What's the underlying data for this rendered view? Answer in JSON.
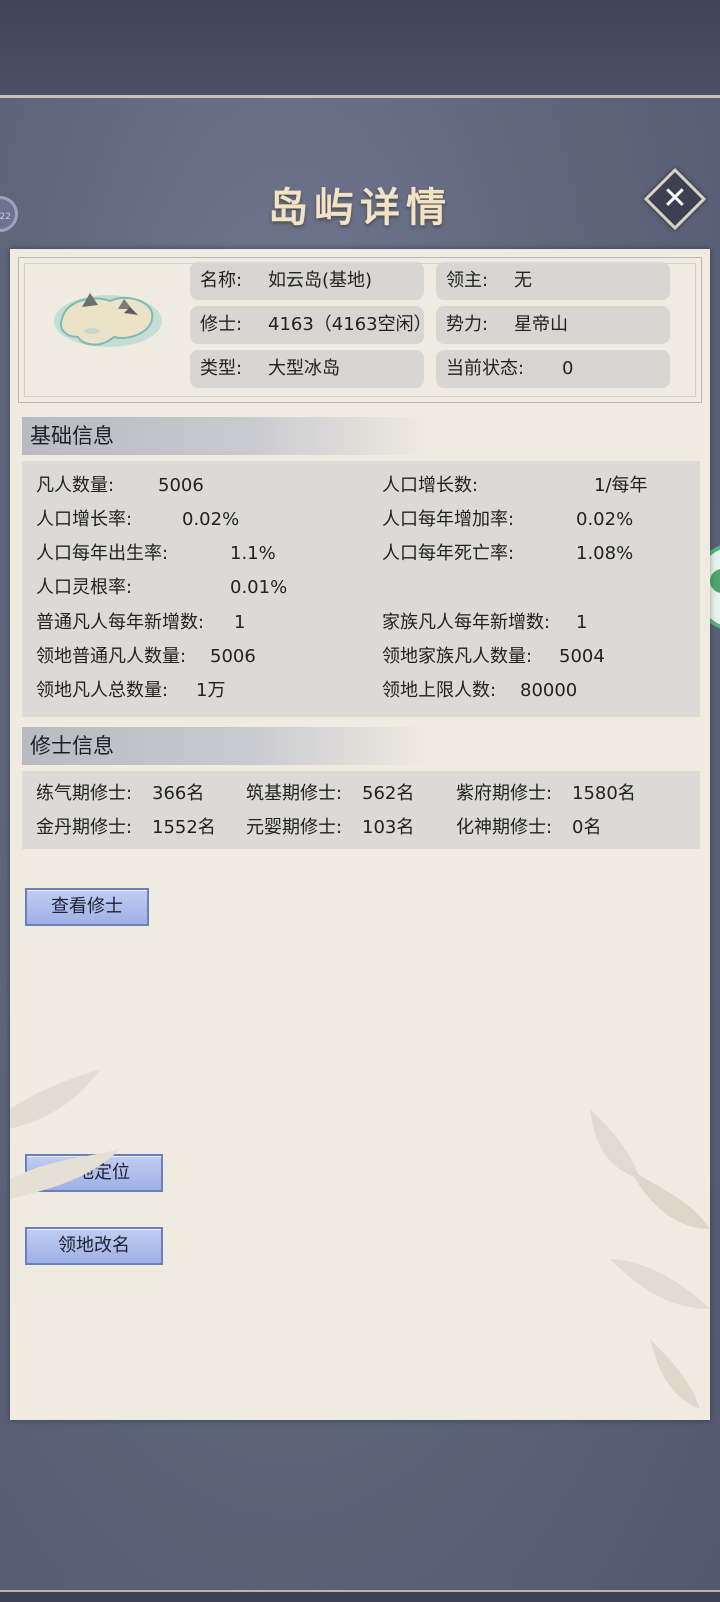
{
  "title": "岛屿详情",
  "side_badge": "22",
  "island": {
    "name_label": "名称:",
    "name_value": "如云岛(基地)",
    "lord_label": "领主:",
    "lord_value": "无",
    "cultivators_label": "修士:",
    "cultivators_value": "4163（4163空闲）",
    "faction_label": "势力:",
    "faction_value": "星帝山",
    "type_label": "类型:",
    "type_value": "大型冰岛",
    "status_label": "当前状态:",
    "status_value": "0"
  },
  "basic_info": {
    "header": "基础信息",
    "rows": [
      {
        "label": "凡人数量:",
        "value": "5006"
      },
      {
        "label": "人口增长数:",
        "value": "1/每年"
      },
      {
        "label": "人口增长率:",
        "value": "0.02%"
      },
      {
        "label": "人口每年增加率:",
        "value": "0.02%"
      },
      {
        "label": "人口每年出生率:",
        "value": "1.1%"
      },
      {
        "label": "人口每年死亡率:",
        "value": "1.08%"
      },
      {
        "label": "人口灵根率:",
        "value": "0.01%"
      },
      {
        "label": "普通凡人每年新增数:",
        "value": "1"
      },
      {
        "label": "家族凡人每年新增数:",
        "value": "1"
      },
      {
        "label": "领地普通凡人数量:",
        "value": "5006"
      },
      {
        "label": "领地家族凡人数量:",
        "value": "5004"
      },
      {
        "label": "领地凡人总数量:",
        "value": "1万"
      },
      {
        "label": "领地上限人数:",
        "value": "80000"
      }
    ]
  },
  "cultivator_info": {
    "header": "修士信息",
    "items": [
      {
        "label": "练气期修士:",
        "value": "366名"
      },
      {
        "label": "筑基期修士:",
        "value": "562名"
      },
      {
        "label": "紫府期修士:",
        "value": "1580名"
      },
      {
        "label": "金丹期修士:",
        "value": "1552名"
      },
      {
        "label": "元婴期修士:",
        "value": "103名"
      },
      {
        "label": "化神期修士:",
        "value": "0名"
      }
    ]
  },
  "buttons": {
    "view_cultivators": "查看修士",
    "locate_territory": "领地定位",
    "rename_territory": "领地改名"
  }
}
